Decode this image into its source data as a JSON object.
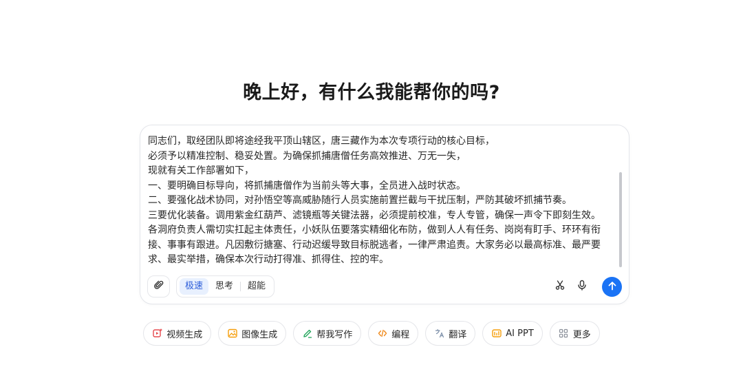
{
  "greeting": "晚上好，有什么我能帮你的吗?",
  "message": {
    "lines": [
      "同志们，取经团队即将途经我平顶山辖区，唐三藏作为本次专项行动的核心目标，",
      "必须予以精准控制、稳妥处置。为确保抓捕唐僧任务高效推进、万无一失，",
      "现就有关工作部署如下，",
      "一、要明确目标导向，将抓捕唐僧作为当前头等大事，全员进入战时状态。",
      "二、要强化战术协同，对孙悟空等高威胁随行人员实施前置拦截与干扰压制，严防其破坏抓捕节奏。",
      "三要优化装备。调用紫金红葫芦、滤镜瓶等关键法器，必须提前校准，专人专管，确保一声令下即刻生效。",
      "各洞府负责人需切实扛起主体责任，小妖队伍要落实精细化布防，做到人人有任务、岗岗有盯手、环环有衔接、事事有跟进。凡因敷衍搪塞、行动迟缓导致目标脱逃者，一律严肃追责。大家务必以最高标准、最严要求、最实举措，确保本次行动打得准、抓得住、控的牢。"
    ]
  },
  "modes": {
    "fast": "极速",
    "think": "思考",
    "super": "超能",
    "active": "fast"
  },
  "quick_actions": [
    {
      "label": "视频生成",
      "icon": "video-gen-icon",
      "color": "#e5484d"
    },
    {
      "label": "图像生成",
      "icon": "image-gen-icon",
      "color": "#f59e0b"
    },
    {
      "label": "帮我写作",
      "icon": "pen-icon",
      "color": "#22a55b"
    },
    {
      "label": "编程",
      "icon": "code-icon",
      "color": "#f08a1c"
    },
    {
      "label": "翻译",
      "icon": "translate-icon",
      "color": "#7b8ea8"
    },
    {
      "label": "AI PPT",
      "icon": "ppt-icon",
      "color": "#f59e0b"
    },
    {
      "label": "更多",
      "icon": "grid-icon",
      "color": "#8a8f99"
    }
  ],
  "colors": {
    "accent": "#1a73f5",
    "active_mode_bg": "#e8f0fe"
  }
}
